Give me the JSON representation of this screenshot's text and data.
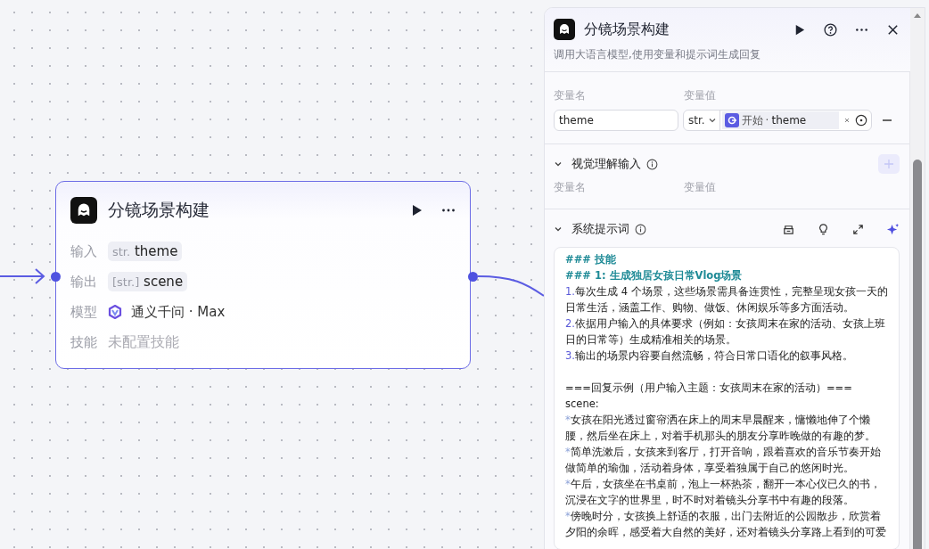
{
  "node": {
    "title": "分镜场景构建",
    "rows": [
      {
        "kind": "var",
        "label": "输入",
        "type": "str.",
        "name": "theme"
      },
      {
        "kind": "var",
        "label": "输出",
        "type": "[str.]",
        "name": "scene"
      },
      {
        "kind": "model",
        "label": "模型",
        "value": "通义千问 · Max"
      },
      {
        "kind": "muted",
        "label": "技能",
        "value": "未配置技能"
      }
    ]
  },
  "panel": {
    "title": "分镜场景构建",
    "subtitle": "调用大语言模型,使用变量和提示词生成回复",
    "inputs": {
      "col_name": "变量名",
      "col_value": "变量值",
      "rows": [
        {
          "name": "theme",
          "type": "str.",
          "ref_source": "开始",
          "ref_sep": "·",
          "ref_name": "theme"
        }
      ]
    },
    "vision": {
      "title": "视觉理解输入",
      "col_name": "变量名",
      "col_value": "变量值",
      "expanded": true
    },
    "prompt": {
      "title": "系统提示词",
      "expanded": true,
      "lines": [
        {
          "kind": "heading",
          "text": "### 技能"
        },
        {
          "kind": "heading",
          "text": "### 1: 生成独居女孩日常Vlog场景"
        },
        {
          "kind": "item",
          "marker": "1.",
          "text": "每次生成 4 个场景，这些场景需具备连贯性，完整呈现女孩一天的"
        },
        {
          "kind": "plain",
          "text": "日常生活，涵盖工作、购物、做饭、休闲娱乐等多方面活动。"
        },
        {
          "kind": "item",
          "marker": "2.",
          "text": "依据用户输入的具体要求（例如：女孩周末在家的活动、女孩上班"
        },
        {
          "kind": "plain",
          "text": "日的日常等）生成精准相关的场景。"
        },
        {
          "kind": "item",
          "marker": "3.",
          "text": "输出的场景内容要自然流畅，符合日常口语化的叙事风格。"
        },
        {
          "kind": "plain",
          "text": "===回复示例（用户输入主题：女孩周末在家的活动）===",
          "space_before": true
        },
        {
          "kind": "plain",
          "text": "scene:"
        },
        {
          "kind": "bullet",
          "marker": "*",
          "text": "女孩在阳光透过窗帘洒在床上的周末早晨醒来，慵懒地伸了个懒"
        },
        {
          "kind": "plain",
          "text": "腰，然后坐在床上，对着手机那头的朋友分享昨晚做的有趣的梦。"
        },
        {
          "kind": "bullet",
          "marker": "*",
          "text": "简单洗漱后，女孩来到客厅，打开音响，跟着喜欢的音乐节奏开始"
        },
        {
          "kind": "plain",
          "text": "做简单的瑜伽，活动着身体，享受着独属于自己的悠闲时光。"
        },
        {
          "kind": "bullet",
          "marker": "*",
          "text": "午后，女孩坐在书桌前，泡上一杯热茶，翻开一本心仪已久的书，"
        },
        {
          "kind": "plain",
          "text": "沉浸在文字的世界里，时不时对着镜头分享书中有趣的段落。"
        },
        {
          "kind": "bullet",
          "marker": "*",
          "text": "傍晚时分，女孩换上舒适的衣服，出门去附近的公园散步，欣赏着"
        },
        {
          "kind": "plain",
          "text": "夕阳的余晖，感受着大自然的美好，还对着镜头分享路上看到的可爱"
        }
      ]
    }
  }
}
